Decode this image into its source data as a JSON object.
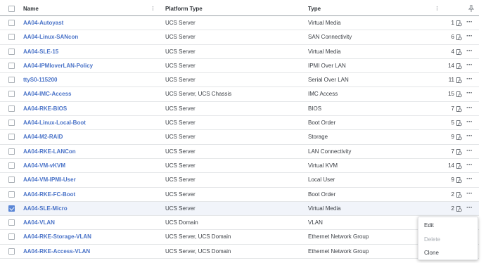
{
  "header": {
    "name": "Name",
    "platform": "Platform Type",
    "type": "Type"
  },
  "rows": [
    {
      "name": "AA04-Autoyast",
      "platform": "UCS Server",
      "type": "Virtual Media",
      "count": "1",
      "selected": false
    },
    {
      "name": "AA04-Linux-SANcon",
      "platform": "UCS Server",
      "type": "SAN Connectivity",
      "count": "6",
      "selected": false
    },
    {
      "name": "AA04-SLE-15",
      "platform": "UCS Server",
      "type": "Virtual Media",
      "count": "4",
      "selected": false
    },
    {
      "name": "AA04-IPMIoverLAN-Policy",
      "platform": "UCS Server",
      "type": "IPMI Over LAN",
      "count": "14",
      "selected": false
    },
    {
      "name": "ttyS0-115200",
      "platform": "UCS Server",
      "type": "Serial Over LAN",
      "count": "11",
      "selected": false
    },
    {
      "name": "AA04-IMC-Access",
      "platform": "UCS Server, UCS Chassis",
      "type": "IMC Access",
      "count": "15",
      "selected": false
    },
    {
      "name": "AA04-RKE-BIOS",
      "platform": "UCS Server",
      "type": "BIOS",
      "count": "7",
      "selected": false
    },
    {
      "name": "AA04-Linux-Local-Boot",
      "platform": "UCS Server",
      "type": "Boot Order",
      "count": "5",
      "selected": false
    },
    {
      "name": "AA04-M2-RAID",
      "platform": "UCS Server",
      "type": "Storage",
      "count": "9",
      "selected": false
    },
    {
      "name": "AA04-RKE-LANCon",
      "platform": "UCS Server",
      "type": "LAN Connectivity",
      "count": "7",
      "selected": false
    },
    {
      "name": "AA04-VM-vKVM",
      "platform": "UCS Server",
      "type": "Virtual KVM",
      "count": "14",
      "selected": false
    },
    {
      "name": "AA04-VM-IPMI-User",
      "platform": "UCS Server",
      "type": "Local User",
      "count": "9",
      "selected": false
    },
    {
      "name": "AA04-RKE-FC-Boot",
      "platform": "UCS Server",
      "type": "Boot Order",
      "count": "2",
      "selected": false
    },
    {
      "name": "AA04-SLE-Micro",
      "platform": "UCS Server",
      "type": "Virtual Media",
      "count": "2",
      "selected": true
    },
    {
      "name": "AA04-VLAN",
      "platform": "UCS Domain",
      "type": "VLAN",
      "count": "",
      "selected": false
    },
    {
      "name": "AA04-RKE-Storage-VLAN",
      "platform": "UCS Server, UCS Domain",
      "type": "Ethernet Network Group",
      "count": "",
      "selected": false
    },
    {
      "name": "AA04-RKE-Access-VLAN",
      "platform": "UCS Server, UCS Domain",
      "type": "Ethernet Network Group",
      "count": "",
      "selected": false
    }
  ],
  "context_menu": {
    "edit": "Edit",
    "delete": "Delete",
    "clone": "Clone"
  },
  "icons": {
    "usage": "policy-usage-icon",
    "more": "more-actions-icon",
    "sort": "column-resize-icon",
    "pin": "pin-icon"
  },
  "colors": {
    "link": "#4a73c8",
    "checkbox_checked": "#5a86d6",
    "selected_row": "#f1f4fa"
  }
}
